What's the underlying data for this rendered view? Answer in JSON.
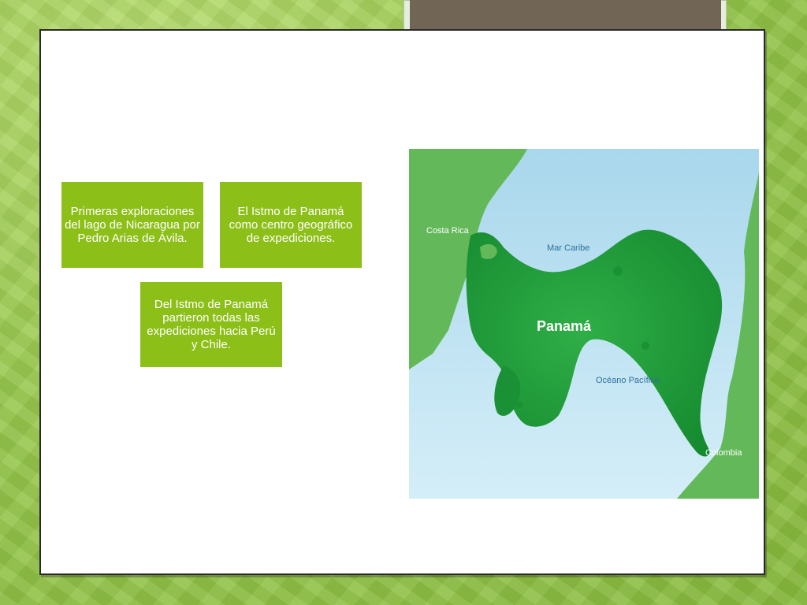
{
  "boxes": {
    "box1": "Primeras exploraciones del lago de Nicaragua por Pedro Arias de Ávila.",
    "box2": "El Istmo de Panamá como centro geográfico de expediciones.",
    "box3": "Del Istmo de Panamá partieron todas las expediciones hacia Perú y Chile."
  },
  "map": {
    "labels": {
      "costa_rica": "Costa Rica",
      "mar_caribe": "Mar Caribe",
      "panama": "Panamá",
      "oceano_pacifico": "Océano Pacífico",
      "colombia": "Colombia"
    },
    "colors": {
      "sea": "#bfe3f3",
      "land_main": "#1f9a3a",
      "land_neighbors": "#63b85a"
    }
  },
  "colors": {
    "box_green": "#8dbf19",
    "title_bar": "#716656",
    "background_green": "#98c84e"
  }
}
